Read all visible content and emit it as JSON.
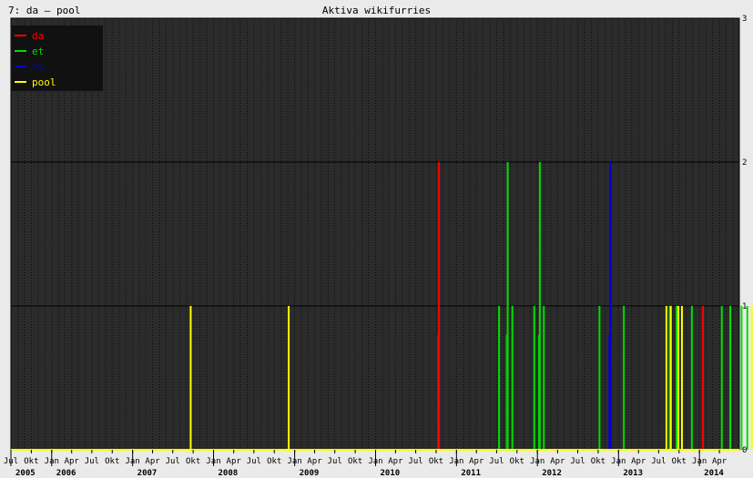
{
  "header": {
    "left_label": "7: da – pool"
  },
  "colors": {
    "background": "#eaeaea",
    "plot_background": "#2b2b2b",
    "minor_grid": "#0c0c0c",
    "major_grid": "#000000",
    "axis_baseline": "#ffff00",
    "legend_background": "#111111"
  },
  "chart_data": {
    "type": "line",
    "title": "Aktiva wikifurries",
    "xlabel": "",
    "ylabel": "",
    "x_type": "date",
    "xlim": [
      "2005-07-01",
      "2014-06-30"
    ],
    "ylim": [
      0,
      3
    ],
    "yticks": [
      0,
      1,
      2,
      3
    ],
    "grid": true,
    "legend_position": "top-left",
    "x_month_ticks": [
      {
        "date": "2005-07-01",
        "label": "Jul"
      },
      {
        "date": "2005-10-01",
        "label": "Okt"
      },
      {
        "date": "2006-01-01",
        "label": "Jan"
      },
      {
        "date": "2006-04-01",
        "label": "Apr"
      },
      {
        "date": "2006-07-01",
        "label": "Jul"
      },
      {
        "date": "2006-10-01",
        "label": "Okt"
      },
      {
        "date": "2007-01-01",
        "label": "Jan"
      },
      {
        "date": "2007-04-01",
        "label": "Apr"
      },
      {
        "date": "2007-07-01",
        "label": "Jul"
      },
      {
        "date": "2007-10-01",
        "label": "Okt"
      },
      {
        "date": "2008-01-01",
        "label": "Jan"
      },
      {
        "date": "2008-04-01",
        "label": "Apr"
      },
      {
        "date": "2008-07-01",
        "label": "Jul"
      },
      {
        "date": "2008-10-01",
        "label": "Okt"
      },
      {
        "date": "2009-01-01",
        "label": "Jan"
      },
      {
        "date": "2009-04-01",
        "label": "Apr"
      },
      {
        "date": "2009-07-01",
        "label": "Jul"
      },
      {
        "date": "2009-10-01",
        "label": "Okt"
      },
      {
        "date": "2010-01-01",
        "label": "Jan"
      },
      {
        "date": "2010-04-01",
        "label": "Apr"
      },
      {
        "date": "2010-07-01",
        "label": "Jul"
      },
      {
        "date": "2010-10-01",
        "label": "Okt"
      },
      {
        "date": "2011-01-01",
        "label": "Jan"
      },
      {
        "date": "2011-04-01",
        "label": "Apr"
      },
      {
        "date": "2011-07-01",
        "label": "Jul"
      },
      {
        "date": "2011-10-01",
        "label": "Okt"
      },
      {
        "date": "2012-01-01",
        "label": "Jan"
      },
      {
        "date": "2012-04-01",
        "label": "Apr"
      },
      {
        "date": "2012-07-01",
        "label": "Jul"
      },
      {
        "date": "2012-10-01",
        "label": "Okt"
      },
      {
        "date": "2013-01-01",
        "label": "Jan"
      },
      {
        "date": "2013-04-01",
        "label": "Apr"
      },
      {
        "date": "2013-07-01",
        "label": "Jul"
      },
      {
        "date": "2013-10-01",
        "label": "Okt"
      },
      {
        "date": "2014-01-01",
        "label": "Jan"
      },
      {
        "date": "2014-04-01",
        "label": "Apr"
      }
    ],
    "x_year_ticks": [
      {
        "date": "2005-07-01",
        "label": "2005"
      },
      {
        "date": "2006-01-01",
        "label": "2006"
      },
      {
        "date": "2007-01-01",
        "label": "2007"
      },
      {
        "date": "2008-01-01",
        "label": "2008"
      },
      {
        "date": "2009-01-01",
        "label": "2009"
      },
      {
        "date": "2010-01-01",
        "label": "2010"
      },
      {
        "date": "2011-01-01",
        "label": "2011"
      },
      {
        "date": "2012-01-01",
        "label": "2012"
      },
      {
        "date": "2013-01-01",
        "label": "2013"
      },
      {
        "date": "2014-01-01",
        "label": "2014"
      }
    ],
    "series": [
      {
        "name": "da",
        "color": "#ff0000",
        "spikes": [
          {
            "date": "2010-10-14",
            "value": 2
          },
          {
            "date": "2014-01-17",
            "value": 1
          }
        ]
      },
      {
        "name": "et",
        "color": "#00dd00",
        "spikes": [
          {
            "date": "2011-07-12",
            "value": 1
          },
          {
            "date": "2011-08-20",
            "value": 2
          },
          {
            "date": "2011-09-10",
            "value": 1
          },
          {
            "date": "2011-12-18",
            "value": 1
          },
          {
            "date": "2012-01-12",
            "value": 2
          },
          {
            "date": "2012-01-30",
            "value": 1
          },
          {
            "date": "2012-10-07",
            "value": 1
          },
          {
            "date": "2013-01-25",
            "value": 1
          },
          {
            "date": "2013-08-20",
            "value": 1
          },
          {
            "date": "2013-09-20",
            "value": 1
          },
          {
            "date": "2013-11-28",
            "value": 1
          },
          {
            "date": "2014-04-12",
            "value": 1
          },
          {
            "date": "2014-05-20",
            "value": 1
          },
          {
            "date": "2014-07-10",
            "value": 1
          },
          {
            "date": "2014-08-05",
            "value": 1
          }
        ]
      },
      {
        "name": "es",
        "color": "#0000dd",
        "spikes": [
          {
            "date": "2012-11-25",
            "value": 2
          }
        ]
      },
      {
        "name": "pool",
        "color": "#ffff00",
        "spikes": [
          {
            "date": "2007-09-20",
            "value": 1
          },
          {
            "date": "2008-12-05",
            "value": 1
          },
          {
            "date": "2013-08-05",
            "value": 1
          },
          {
            "date": "2013-08-25",
            "value": 1
          },
          {
            "date": "2013-09-28",
            "value": 1
          },
          {
            "date": "2013-10-14",
            "value": 1
          },
          {
            "date": "2014-08-25",
            "value": 1
          }
        ]
      }
    ]
  }
}
